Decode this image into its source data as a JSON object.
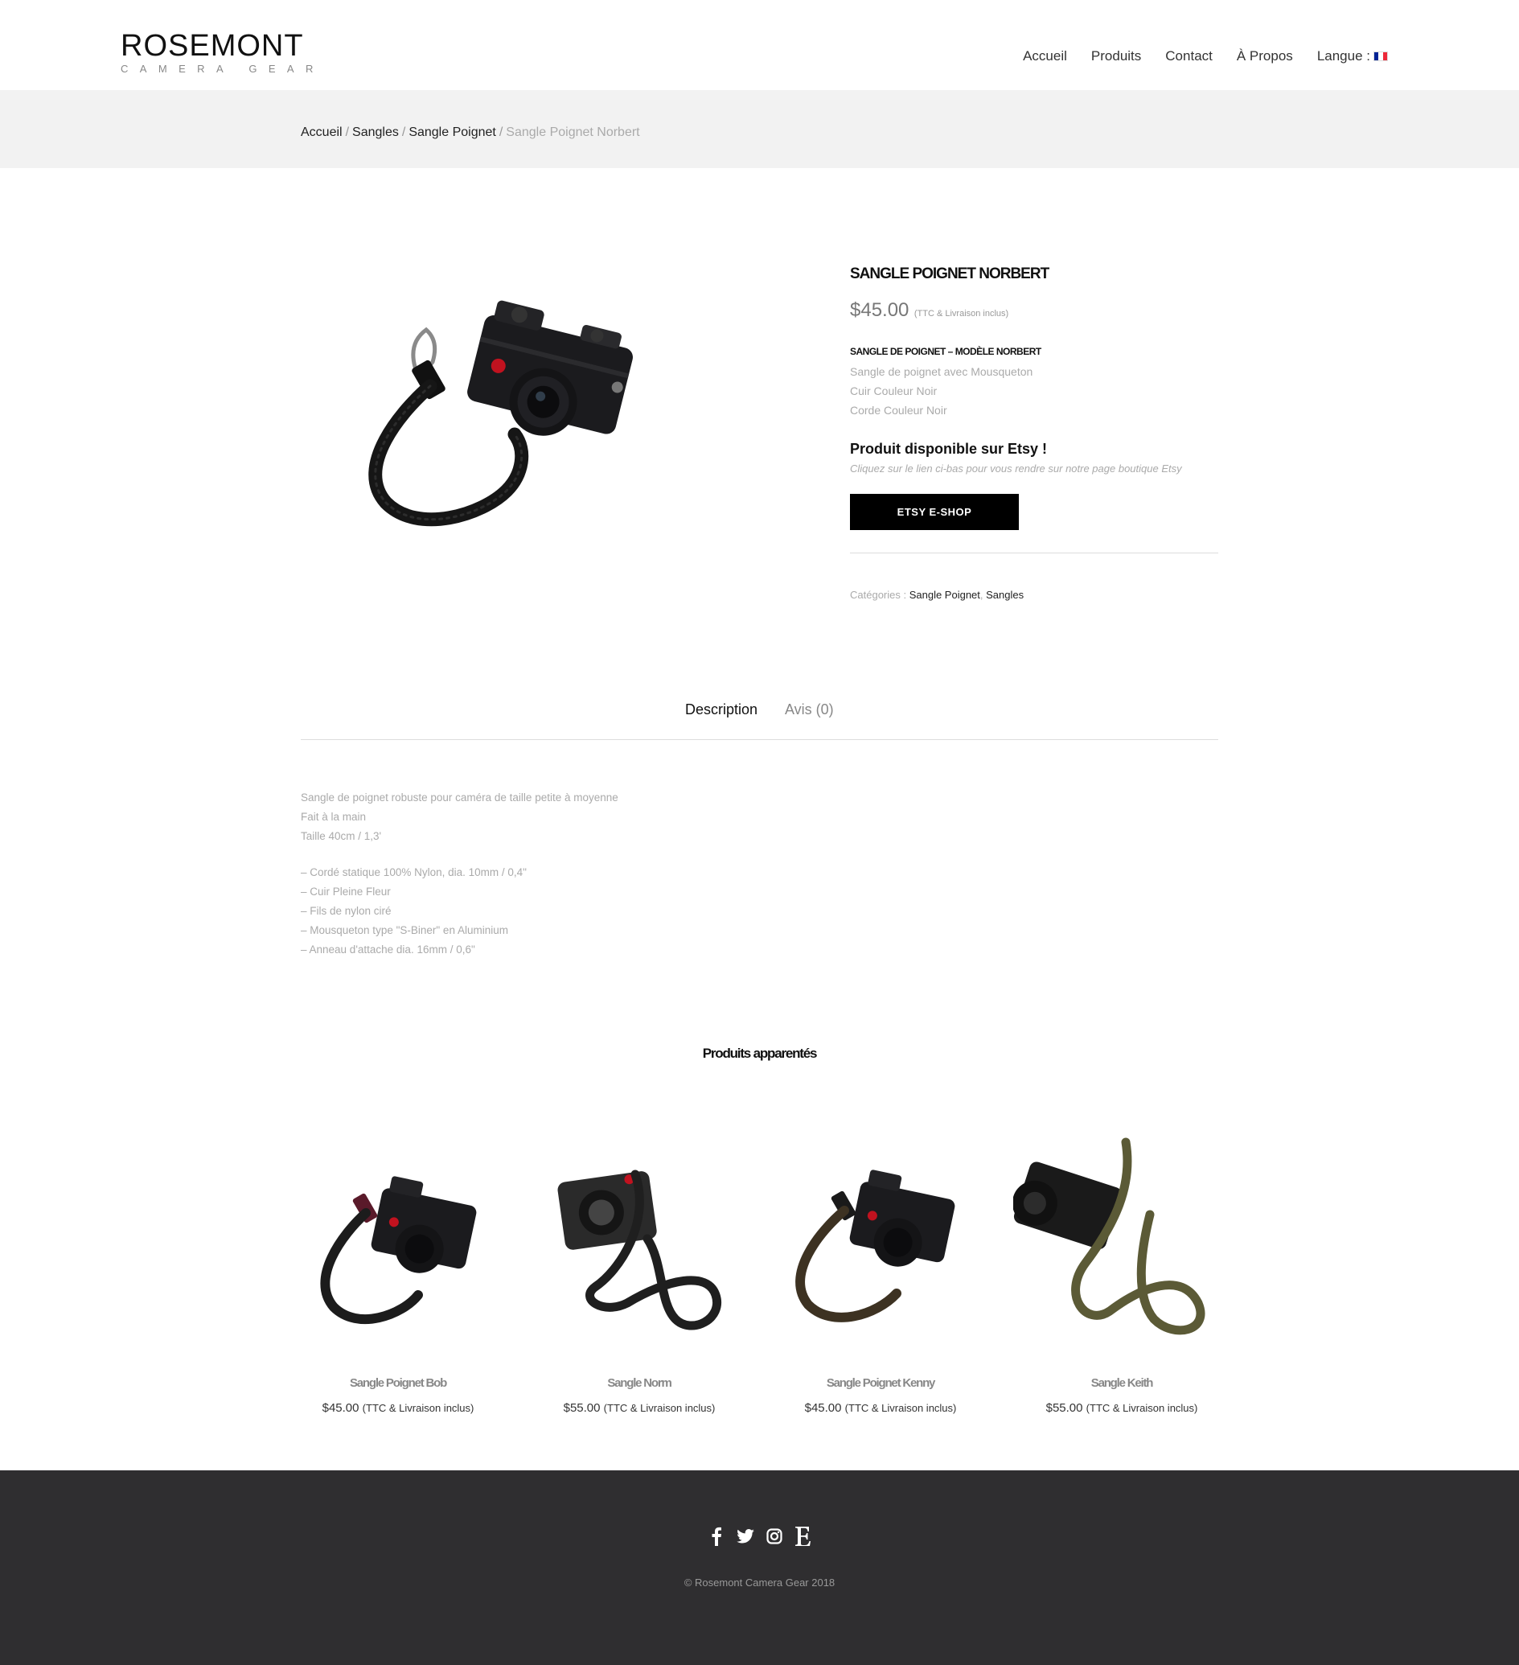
{
  "header": {
    "logo_main": "ROSEMONT",
    "logo_sub": "CAMERA GEAR",
    "nav": [
      "Accueil",
      "Produits",
      "Contact",
      "À Propos",
      "Langue :"
    ],
    "flag_colors": [
      "#002395",
      "#ffffff",
      "#ed2939"
    ]
  },
  "breadcrumb": {
    "items": [
      "Accueil",
      "Sangles",
      "Sangle Poignet"
    ],
    "current": "Sangle Poignet Norbert"
  },
  "product": {
    "title": "SANGLE POIGNET NORBERT",
    "price": "$45.00",
    "tax_note": "(TTC & Livraison inclus)",
    "subhead": "SANGLE DE POIGNET – MODÈLE NORBERT",
    "features": [
      "Sangle de poignet avec Mousqueton",
      "Cuir Couleur Noir",
      "Corde Couleur Noir"
    ],
    "etsy_title": "Produit disponible sur Etsy !",
    "etsy_note": "Cliquez sur le lien ci-bas pour vous rendre sur notre page boutique Etsy",
    "etsy_button": "ETSY E-SHOP",
    "categories_label": "Catégories :",
    "categories": [
      "Sangle Poignet",
      "Sangles"
    ],
    "image_icon": "camera-wrist-strap-black"
  },
  "tabs": {
    "description": "Description",
    "reviews": "Avis (0)"
  },
  "description": {
    "lines": [
      "Sangle de poignet robuste pour caméra de taille petite à moyenne",
      "Fait à la main",
      "Taille 40cm / 1,3'"
    ],
    "specs": [
      "– Cordé statique 100% Nylon, dia. 10mm / 0,4\"",
      "– Cuir Pleine Fleur",
      "– Fils de nylon ciré",
      "– Mousqueton type \"S-Biner\" en Aluminium",
      "– Anneau d'attache dia. 16mm / 0,6\""
    ]
  },
  "related": {
    "title": "Produits apparentés",
    "items": [
      {
        "name": "Sangle Poignet Bob",
        "price": "$45.00",
        "tax": "(TTC & Livraison inclus)",
        "strap_color": "#1c1c1c",
        "leather_color": "#5a1a2a"
      },
      {
        "name": "Sangle Norm",
        "price": "$55.00",
        "tax": "(TTC & Livraison inclus)",
        "strap_color": "#1f1f1f",
        "leather_color": "#222222"
      },
      {
        "name": "Sangle Poignet Kenny",
        "price": "$45.00",
        "tax": "(TTC & Livraison inclus)",
        "strap_color": "#3d3222",
        "leather_color": "#1a1a1a"
      },
      {
        "name": "Sangle Keith",
        "price": "$55.00",
        "tax": "(TTC & Livraison inclus)",
        "strap_color": "#5b5a36",
        "leather_color": "#1a1a1a"
      }
    ]
  },
  "footer": {
    "social": [
      "facebook-icon",
      "twitter-icon",
      "instagram-icon",
      "etsy-icon"
    ],
    "copyright": "© Rosemont Camera Gear 2018"
  }
}
